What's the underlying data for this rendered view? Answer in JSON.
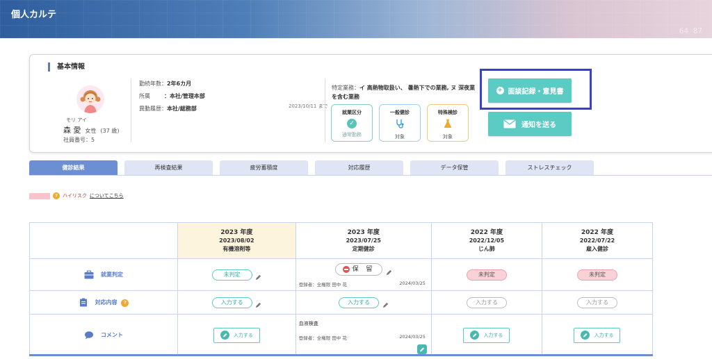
{
  "app": {
    "title": "個人カルテ",
    "header_deco": "64 87"
  },
  "basic_info": {
    "section_title": "基本情報",
    "name_kana": "モリ アイ",
    "name": "森 愛",
    "gender": "女性",
    "age": "(37 歳)",
    "employee_no": "社員番号：5",
    "tenure_label": "勤続年数：",
    "tenure_value": "2年6カ月",
    "dept_label": "所属",
    "dept_value": "：本社/管理本部",
    "transfer_label": "異動履歴：",
    "transfer_value": "本社/総務部",
    "transfer_date": "2023/10/11 まで",
    "special_work_label": "特定業務：",
    "special_work_value": "イ 高熱物取扱い、 暑熱下での業務, ヌ 深夜業を含む業務",
    "status_boxes": [
      {
        "title": "就業区分",
        "footer": "通常勤務"
      },
      {
        "title": "一般健診",
        "footer": "対象"
      },
      {
        "title": "特殊検診",
        "footer": "対象"
      }
    ]
  },
  "actions": {
    "meeting_label": "面談記録・意見書",
    "notify_label": "通知を送る"
  },
  "tabs": [
    {
      "label": "健診結果",
      "active": true
    },
    {
      "label": "再検査結果",
      "active": false
    },
    {
      "label": "疲労蓄積度",
      "active": false
    },
    {
      "label": "対応履歴",
      "active": false
    },
    {
      "label": "データ保管",
      "active": false
    },
    {
      "label": "ストレスチェック",
      "active": false
    }
  ],
  "legend": {
    "high_risk": "ハイリスク",
    "link": "についてこちら",
    "q": "?"
  },
  "table": {
    "columns": [
      {
        "year": "2023 年度",
        "date": "2023/08/02",
        "type": "有機溶剤等"
      },
      {
        "year": "2023 年度",
        "date": "2023/07/25",
        "type": "定期健診"
      },
      {
        "year": "2022 年度",
        "date": "2022/12/05",
        "type": "じん肺"
      },
      {
        "year": "2022 年度",
        "date": "2022/07/22",
        "type": "雇入健診"
      }
    ],
    "rows": {
      "work_label": "就業判定",
      "response_label": "対応内容",
      "comment_label": "コメント"
    },
    "work": [
      "未判定",
      "保 留",
      "未判定",
      "未判定"
    ],
    "response": [
      "入力する",
      "入力する",
      "入力する",
      "入力する"
    ],
    "comment_btn": "入力する",
    "registrant": "登録者：全権限 田中 花",
    "reg_date": "2024/03/25",
    "comment_text": "血液検査"
  },
  "colors": {
    "accent": "#5ccbc3",
    "tab_active": "#6c8fd3",
    "highlight": "#3c40c6"
  }
}
